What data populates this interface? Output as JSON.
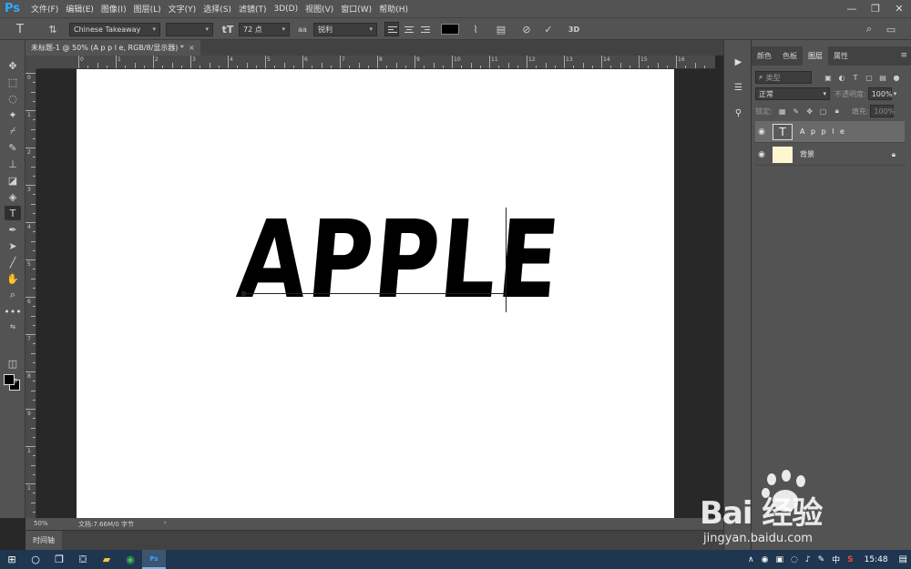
{
  "app": {
    "logo": "Ps",
    "menu": [
      "文件(F)",
      "编辑(E)",
      "图像(I)",
      "图层(L)",
      "文字(Y)",
      "选择(S)",
      "滤镜(T)",
      "3D(D)",
      "视图(V)",
      "窗口(W)",
      "帮助(H)"
    ],
    "window_controls": [
      "—",
      "❐",
      "✕"
    ]
  },
  "options": {
    "font_family": "Chinese Takeaway",
    "font_style": "",
    "font_size": "72 点",
    "antialias_label": "aa",
    "antialias": "锐利",
    "label_3d": "3D"
  },
  "document": {
    "tab_title": "未标题-1 @ 50% (A p p l e, RGB/8/显示器) *",
    "close": "×",
    "text_content": "APPLE"
  },
  "rulers": {
    "h_labels": [
      "0",
      "1",
      "2",
      "3",
      "4",
      "5",
      "6",
      "7",
      "8",
      "9",
      "10",
      "11",
      "12",
      "13",
      "14",
      "15",
      "16"
    ],
    "v_labels": [
      "0",
      "1",
      "2",
      "3",
      "4",
      "5",
      "6",
      "7",
      "8",
      "9",
      "1",
      "1",
      "1"
    ]
  },
  "status": {
    "zoom": "50%",
    "doc_info": "文档:7.66M/0 字节",
    "arrow": "›"
  },
  "timeline": {
    "label": "时间轴"
  },
  "panel": {
    "tabs": [
      "颜色",
      "色板",
      "图层",
      "属性"
    ],
    "active_tab": "图层",
    "search_placeholder": "类型",
    "blend_mode": "正常",
    "opacity_label": "不透明度:",
    "opacity": "100%",
    "lock_label": "锁定:",
    "fill_label": "填充:",
    "fill": "100%",
    "layers": [
      {
        "name": "A p p l e",
        "type": "text",
        "thumb": "T"
      },
      {
        "name": "背景",
        "type": "background",
        "thumb_color": "#fdf6d0"
      }
    ]
  },
  "watermark": {
    "logo": "Bai  经验",
    "url": "jingyan.baidu.com"
  },
  "taskbar": {
    "time": "15:48",
    "ime": "中",
    "tray": [
      "∧",
      "◉",
      "▣",
      "◌",
      "♪",
      "✎"
    ]
  }
}
